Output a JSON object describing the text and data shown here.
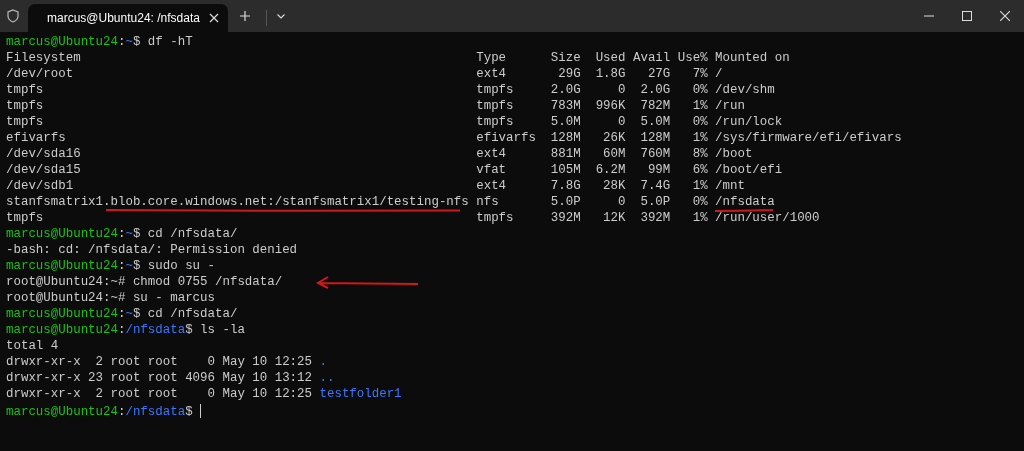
{
  "window": {
    "tab_title": "marcus@Ubuntu24: /nfsdata"
  },
  "terminal": {
    "lines": [
      [
        {
          "kind": "user",
          "text": "marcus@Ubuntu24"
        },
        {
          "kind": "plain",
          "text": ":"
        },
        {
          "kind": "path",
          "text": "~"
        },
        {
          "kind": "plain",
          "text": "$ df -hT"
        }
      ],
      [
        {
          "kind": "plain",
          "text": "Filesystem                                                     Type      Size  Used Avail Use% Mounted on"
        }
      ],
      [
        {
          "kind": "plain",
          "text": "/dev/root                                                      ext4       29G  1.8G   27G   7% /"
        }
      ],
      [
        {
          "kind": "plain",
          "text": "tmpfs                                                          tmpfs     2.0G     0  2.0G   0% /dev/shm"
        }
      ],
      [
        {
          "kind": "plain",
          "text": "tmpfs                                                          tmpfs     783M  996K  782M   1% /run"
        }
      ],
      [
        {
          "kind": "plain",
          "text": "tmpfs                                                          tmpfs     5.0M     0  5.0M   0% /run/lock"
        }
      ],
      [
        {
          "kind": "plain",
          "text": "efivarfs                                                       efivarfs  128M   26K  128M   1% /sys/firmware/efi/efivars"
        }
      ],
      [
        {
          "kind": "plain",
          "text": "/dev/sda16                                                     ext4      881M   60M  760M   8% /boot"
        }
      ],
      [
        {
          "kind": "plain",
          "text": "/dev/sda15                                                     vfat      105M  6.2M   99M   6% /boot/efi"
        }
      ],
      [
        {
          "kind": "plain",
          "text": "/dev/sdb1                                                      ext4      7.8G   28K  7.4G   1% /mnt"
        }
      ],
      [
        {
          "kind": "plain",
          "text": "stanfsmatrix1.blob.core.windows.net:/stanfsmatrix1/testing-nfs nfs       5.0P     0  5.0P   0% /nfsdata"
        }
      ],
      [
        {
          "kind": "plain",
          "text": "tmpfs                                                          tmpfs     392M   12K  392M   1% /run/user/1000"
        }
      ],
      [
        {
          "kind": "user",
          "text": "marcus@Ubuntu24"
        },
        {
          "kind": "plain",
          "text": ":"
        },
        {
          "kind": "path",
          "text": "~"
        },
        {
          "kind": "plain",
          "text": "$ cd /nfsdata/"
        }
      ],
      [
        {
          "kind": "plain",
          "text": "-bash: cd: /nfsdata/: Permission denied"
        }
      ],
      [
        {
          "kind": "user",
          "text": "marcus@Ubuntu24"
        },
        {
          "kind": "plain",
          "text": ":"
        },
        {
          "kind": "path",
          "text": "~"
        },
        {
          "kind": "plain",
          "text": "$ sudo su -"
        }
      ],
      [
        {
          "kind": "plain",
          "text": "root@Ubuntu24:~# chmod 0755 /nfsdata/"
        }
      ],
      [
        {
          "kind": "plain",
          "text": "root@Ubuntu24:~# su - marcus"
        }
      ],
      [
        {
          "kind": "user",
          "text": "marcus@Ubuntu24"
        },
        {
          "kind": "plain",
          "text": ":"
        },
        {
          "kind": "path",
          "text": "~"
        },
        {
          "kind": "plain",
          "text": "$ cd /nfsdata/"
        }
      ],
      [
        {
          "kind": "user",
          "text": "marcus@Ubuntu24"
        },
        {
          "kind": "plain",
          "text": ":"
        },
        {
          "kind": "path",
          "text": "/nfsdata"
        },
        {
          "kind": "plain",
          "text": "$ ls -la"
        }
      ],
      [
        {
          "kind": "plain",
          "text": "total 4"
        }
      ],
      [
        {
          "kind": "plain",
          "text": "drwxr-xr-x  2 root root    0 May 10 12:25 "
        },
        {
          "kind": "dir",
          "text": "."
        }
      ],
      [
        {
          "kind": "plain",
          "text": "drwxr-xr-x 23 root root 4096 May 10 13:12 "
        },
        {
          "kind": "dir",
          "text": ".."
        }
      ],
      [
        {
          "kind": "plain",
          "text": "drwxr-xr-x  2 root root    0 May 10 12:25 "
        },
        {
          "kind": "dir",
          "text": "testfolder1"
        }
      ],
      [
        {
          "kind": "user",
          "text": "marcus@Ubuntu24"
        },
        {
          "kind": "plain",
          "text": ":"
        },
        {
          "kind": "path",
          "text": "/nfsdata"
        },
        {
          "kind": "plain",
          "text": "$ "
        }
      ]
    ]
  }
}
